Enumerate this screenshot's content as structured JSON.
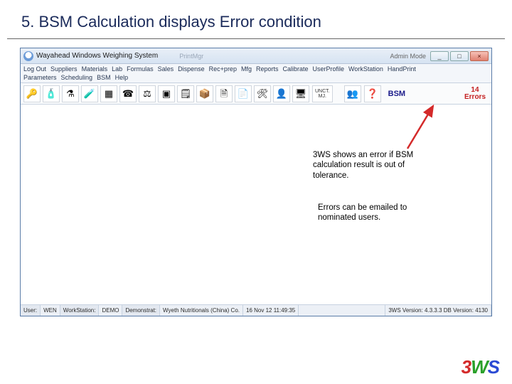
{
  "slide": {
    "title": "5. BSM Calculation displays Error condition"
  },
  "window": {
    "title": "Wayahead Windows Weighing System",
    "faded_text": "PrintMgr",
    "right_text": "Admin Mode"
  },
  "winbuttons": {
    "min": "_",
    "max": "□",
    "close": "×"
  },
  "menu_row1": [
    "Log Out",
    "Suppliers",
    "Materials",
    "Lab",
    "Formulas",
    "Sales",
    "Dispense",
    "Rec+prep",
    "Mfg",
    "Reports",
    "Calibrate",
    "UserProfile",
    "WorkStation",
    "HandPrint"
  ],
  "menu_row2": [
    "Parameters",
    "Scheduling",
    "BSM",
    "Help"
  ],
  "toolbar_icons": [
    {
      "name": "key-icon",
      "glyph": "🔑"
    },
    {
      "name": "bottle-icon",
      "glyph": "🧴"
    },
    {
      "name": "flask-icon",
      "glyph": "⚗"
    },
    {
      "name": "beaker-icon",
      "glyph": "🧪"
    },
    {
      "name": "table-icon",
      "glyph": "▦"
    },
    {
      "name": "phone-icon",
      "glyph": "☎"
    },
    {
      "name": "scale-icon",
      "glyph": "⚖"
    },
    {
      "name": "window-icon",
      "glyph": "▣"
    },
    {
      "name": "form-icon",
      "glyph": "🗒"
    },
    {
      "name": "box-icon",
      "glyph": "📦"
    },
    {
      "name": "doc-icon",
      "glyph": "🗎"
    },
    {
      "name": "report-icon",
      "glyph": "📄"
    },
    {
      "name": "tools-icon",
      "glyph": "🛠"
    },
    {
      "name": "person-icon",
      "glyph": "👤"
    },
    {
      "name": "monitor-icon",
      "glyph": "🖥"
    }
  ],
  "toolbar_blocks": {
    "unct": {
      "line1": "UNCT.",
      "line2": "MJ."
    },
    "two_icon": {
      "glyph": "👥"
    },
    "help_icon": {
      "glyph": "❓"
    }
  },
  "bsm_label": "BSM",
  "errors": {
    "count": "14",
    "label": "Errors"
  },
  "callouts": {
    "c1": "3WS shows an error if BSM calculation result is out of tolerance.",
    "c2": "Errors can be emailed to nominated users."
  },
  "statusbar": {
    "user_lbl": "User:",
    "user_val": "WEN",
    "ws_lbl": "WorkStation:",
    "ws_val": "DEMO",
    "db_lbl": "Demonstrat:",
    "db_val": "Wyeth Nutritionals (China) Co.",
    "time": "16 Nov 12 11:49:35",
    "ver": "3WS Version: 4.3.3.3  DB Version: 4130"
  },
  "brand": {
    "p1": "3",
    "p2": "W",
    "p3": "S"
  }
}
